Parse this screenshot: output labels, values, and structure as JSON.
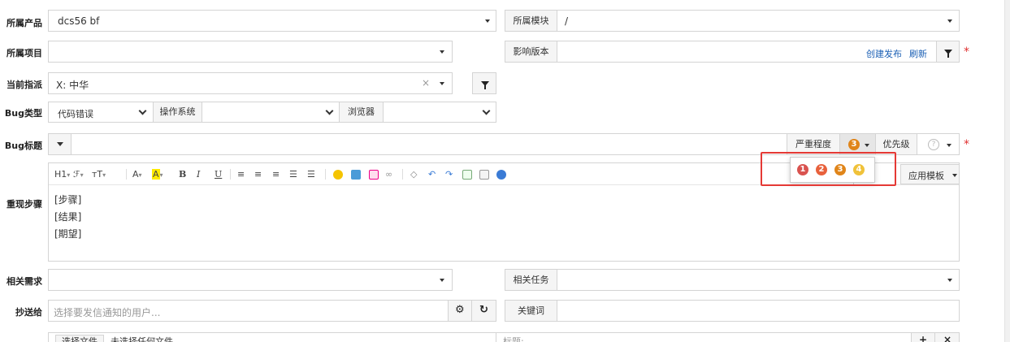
{
  "form": {
    "product": {
      "label": "所属产品",
      "value": "dcs56 bf"
    },
    "module": {
      "label": "所属模块",
      "value": "/"
    },
    "project": {
      "label": "所属项目",
      "value": ""
    },
    "affected_version": {
      "label": "影响版本",
      "value": "",
      "create_release": "创建发布",
      "refresh": "刷新"
    },
    "assigned_to": {
      "label": "当前指派",
      "value": "X: 中华",
      "clear": "×"
    },
    "bug_type": {
      "label": "Bug类型",
      "value": "代码错误",
      "os_label": "操作系统",
      "os_value": "",
      "browser_label": "浏览器",
      "browser_value": ""
    },
    "bug_title": {
      "label": "Bug标题",
      "value": "",
      "severity_label": "严重程度",
      "severity_value": "3",
      "priority_label": "优先级",
      "priority_value": "?"
    },
    "severity_options": [
      "1",
      "2",
      "3",
      "4"
    ],
    "severity_colors": {
      "1": "#d9534f",
      "2": "#e8613c",
      "3": "#e0851a",
      "4": "#f0c23a"
    },
    "steps": {
      "label": "重现步骤",
      "lines": [
        "[步骤]",
        "[结果]",
        "[期望]"
      ],
      "save_template_partial": "模板",
      "apply_template": "应用模板"
    },
    "editor_toolbar": {
      "h1": "H1",
      "font": "ℱ",
      "size": "тT",
      "font_color": "A",
      "bg_color": "A",
      "bold": "B",
      "italic": "I",
      "underline": "U"
    },
    "related_story": {
      "label": "相关需求",
      "value": ""
    },
    "related_task": {
      "label": "相关任务",
      "value": ""
    },
    "cc": {
      "label": "抄送给",
      "placeholder": "选择要发信通知的用户..."
    },
    "keywords": {
      "label": "关键词",
      "value": ""
    },
    "files": {
      "choose": "选择文件",
      "none": "未选择任何文件",
      "title_placeholder": "标题:"
    }
  }
}
